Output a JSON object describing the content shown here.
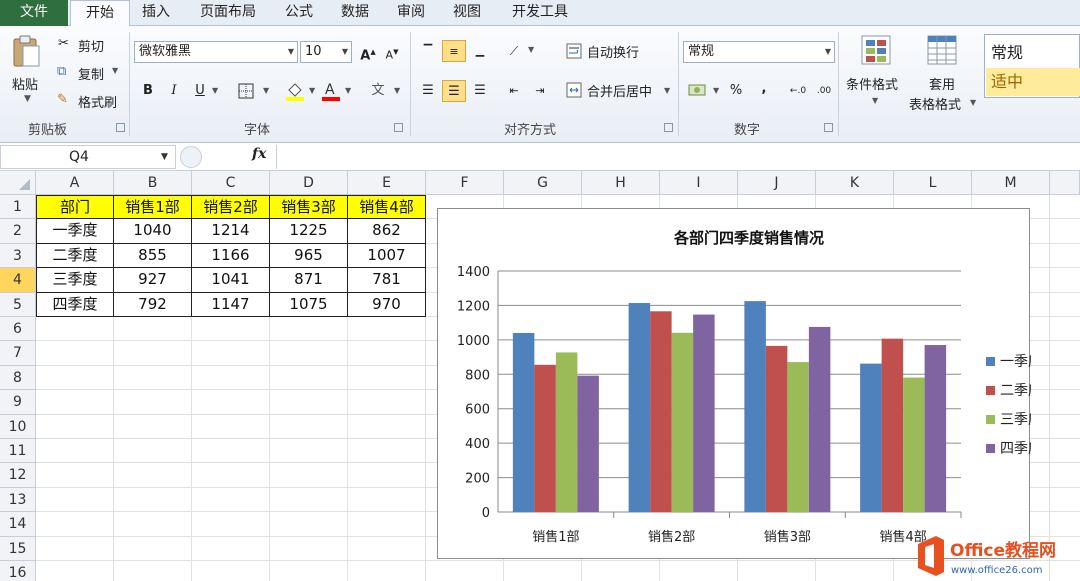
{
  "ribbon": {
    "tabs": [
      "文件",
      "开始",
      "插入",
      "页面布局",
      "公式",
      "数据",
      "审阅",
      "视图",
      "开发工具"
    ],
    "clipboard": {
      "paste": "粘贴",
      "cut": "剪切",
      "copy": "复制",
      "format_painter": "格式刷",
      "label": "剪贴板"
    },
    "font": {
      "name": "微软雅黑",
      "size": "10",
      "bold": "B",
      "italic": "I",
      "underline": "U",
      "label": "字体"
    },
    "alignment": {
      "wrap": "自动换行",
      "merge": "合并后居中",
      "label": "对齐方式"
    },
    "number": {
      "format": "常规",
      "percent": "%",
      "comma": ",",
      "label": "数字"
    },
    "styles": {
      "conditional": "条件格式",
      "table_format_1": "套用",
      "table_format_2": "表格格式",
      "style_normal": "常规",
      "style_neutral": "适中"
    }
  },
  "formula_bar": {
    "name_box": "Q4",
    "fx": "fx",
    "content": ""
  },
  "sheet": {
    "columns": [
      "A",
      "B",
      "C",
      "D",
      "E",
      "F",
      "G",
      "H",
      "I",
      "J",
      "K",
      "L",
      "M"
    ],
    "rows": [
      "1",
      "2",
      "3",
      "4",
      "5",
      "6",
      "7",
      "8",
      "9",
      "10",
      "11",
      "12",
      "13",
      "14",
      "15",
      "16"
    ],
    "selected_row": "4",
    "table": {
      "header": [
        "部门",
        "销售1部",
        "销售2部",
        "销售3部",
        "销售4部"
      ],
      "rows": [
        [
          "一季度",
          "1040",
          "1214",
          "1225",
          "862"
        ],
        [
          "二季度",
          "855",
          "1166",
          "965",
          "1007"
        ],
        [
          "三季度",
          "927",
          "1041",
          "871",
          "781"
        ],
        [
          "四季度",
          "792",
          "1147",
          "1075",
          "970"
        ]
      ]
    }
  },
  "chart_data": {
    "type": "bar",
    "title": "各部门四季度销售情况",
    "categories": [
      "销售1部",
      "销售2部",
      "销售3部",
      "销售4部"
    ],
    "series": [
      {
        "name": "一季度",
        "values": [
          1040,
          1214,
          1225,
          862
        ],
        "color": "#4f81bd"
      },
      {
        "name": "二季度",
        "values": [
          855,
          1166,
          965,
          1007
        ],
        "color": "#c0504d"
      },
      {
        "name": "三季度",
        "values": [
          927,
          1041,
          871,
          781
        ],
        "color": "#9bbb59"
      },
      {
        "name": "四季度",
        "values": [
          792,
          1147,
          1075,
          970
        ],
        "color": "#8064a2"
      }
    ],
    "ylim": [
      0,
      1400
    ],
    "yticks": [
      0,
      200,
      400,
      600,
      800,
      1000,
      1200,
      1400
    ],
    "grid": true,
    "legend": "right"
  },
  "watermark": {
    "brand": "Office教程网",
    "url": "www.office26.com"
  }
}
